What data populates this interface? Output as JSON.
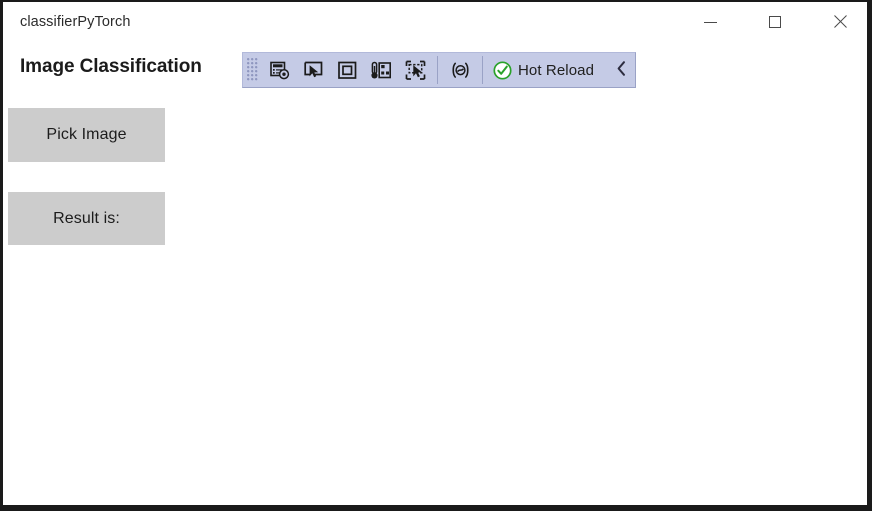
{
  "window": {
    "title": "classifierPyTorch",
    "controls": {
      "minimize": "Minimize",
      "maximize": "Maximize",
      "close": "Close"
    }
  },
  "page": {
    "heading": "Image Classification"
  },
  "toolbar": {
    "name": "XAML Hot Reload in-app toolbar",
    "grip": "drag-grip",
    "icons": [
      {
        "name": "go-to-live-visual-tree-icon",
        "title": "Go to Live Visual Tree"
      },
      {
        "name": "select-element-icon",
        "title": "Select Element"
      },
      {
        "name": "display-layout-adorners-icon",
        "title": "Display Layout Adorners"
      },
      {
        "name": "track-focused-element-icon",
        "title": "Track Focused Element"
      },
      {
        "name": "select-element-in-running-app-icon",
        "title": "Select Element in Running Application"
      },
      {
        "name": "live-property-explorer-icon",
        "title": "Live Property Explorer"
      }
    ],
    "hot_reload": {
      "label": "Hot Reload",
      "status_icon": "check-circle-icon",
      "status_color": "#2aa22a"
    },
    "collapse": "‹",
    "background": "#c5cbe6",
    "border": "#9aa2c6"
  },
  "content": {
    "buttons": [
      {
        "name": "pick-image-button",
        "label": "Pick Image"
      },
      {
        "name": "result-button",
        "label": "Result is:"
      }
    ],
    "button_color": "#cccccc"
  }
}
